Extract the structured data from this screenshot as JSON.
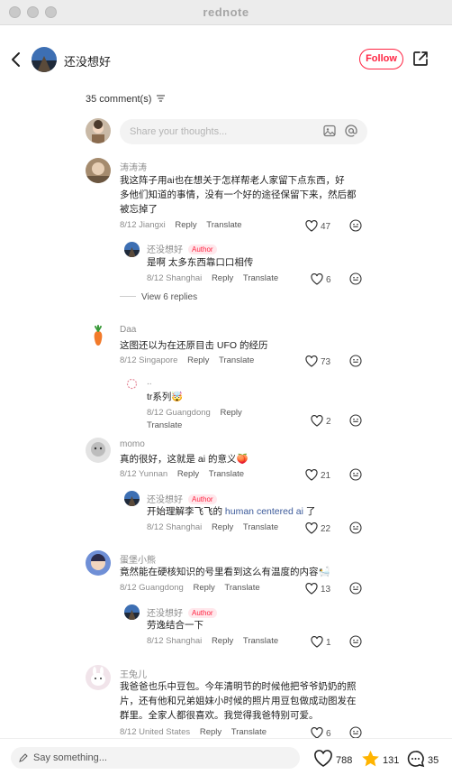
{
  "window": {
    "title": "rednote"
  },
  "header": {
    "username": "还没想好",
    "follow_label": "Follow"
  },
  "comments_header": {
    "count_label": "35 comment(s)"
  },
  "composer": {
    "placeholder": "Share your thoughts..."
  },
  "actions": {
    "reply": "Reply",
    "translate": "Translate"
  },
  "comments": [
    {
      "user": "涛涛涛",
      "text": [
        "我这阵子用ai也在想关于怎样帮老人家留下点东西，好",
        "多他们知道的事情，没有一个好的途径保留下来，然后都",
        "被忘掉了"
      ],
      "date": "8/12",
      "location": "Jiangxi",
      "likes": "47"
    },
    {
      "user": "Daa",
      "text": [
        "这图还以为在还原目击 UFO 的经历"
      ],
      "date": "8/12",
      "location": "Singapore",
      "likes": "73"
    },
    {
      "user": "momo",
      "text": [
        "真的很好，这就是 ai 的意义🍑"
      ],
      "date": "8/12",
      "location": "Yunnan",
      "likes": "21"
    },
    {
      "user": "蛋堡小熊",
      "text": [
        "竟然能在硬核知识的号里看到这么有温度的内容🛀"
      ],
      "date": "8/12",
      "location": "Guangdong",
      "likes": "13"
    },
    {
      "user": "王兔儿",
      "text": [
        "我爸爸也乐中豆包。今年清明节的时候他把爷爷奶奶的照",
        "片，还有他和兄弟姐妹小时候的照片用豆包做成动图发在",
        "群里。全家人都很喜欢。我觉得我爸特别可爱。"
      ],
      "date": "8/12",
      "location": "United States",
      "likes": "6"
    }
  ],
  "replies": [
    {
      "user": "还没想好",
      "badge": "Author",
      "text": "是啊 太多东西靠口口相传",
      "date": "8/12",
      "location": "Shanghai",
      "likes": "6"
    },
    {
      "user": "..",
      "text": "tr系列🤯",
      "date": "8/12",
      "location": "Guangdong",
      "likes": "2"
    },
    {
      "user": "还没想好",
      "badge": "Author",
      "text_pre": "开始理解李飞飞的 ",
      "text_link": "human centered ai",
      "text_post": " 了",
      "date": "8/12",
      "location": "Shanghai",
      "likes": "22"
    },
    {
      "user": "还没想好",
      "badge": "Author",
      "text": "劳逸结合一下",
      "date": "8/12",
      "location": "Shanghai",
      "likes": "1"
    }
  ],
  "view_replies_label": "View 6 replies",
  "bottom_bar": {
    "placeholder": "Say something...",
    "likes": "788",
    "stars": "131",
    "comments": "35"
  },
  "colors": {
    "accent": "#ff2442",
    "star": "#ffb400",
    "link": "#3c5a9a"
  }
}
